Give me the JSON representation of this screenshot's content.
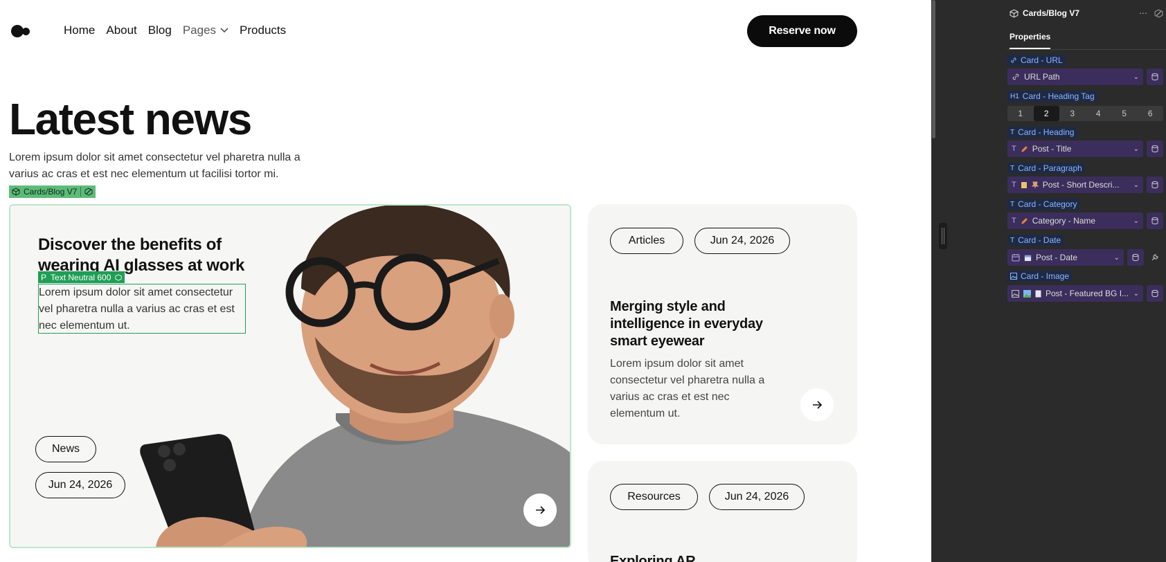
{
  "nav": {
    "items": [
      "Home",
      "About",
      "Blog",
      "Pages",
      "Products"
    ],
    "cta": "Reserve now"
  },
  "hero": {
    "title": "Latest news",
    "subtitle": "Lorem ipsum dolor sit amet consectetur vel pharetra nulla a varius ac cras et est nec elementum ut facilisi tortor mi."
  },
  "selection": {
    "component_badge": "Cards/Blog V7",
    "text_badge_prefix": "P",
    "text_badge": "Text Neutral 600"
  },
  "featured": {
    "heading": "Discover the benefits of wearing AI glasses at work",
    "paragraph": "Lorem ipsum dolor sit amet consectetur vel pharetra nulla a varius ac cras et est nec elementum ut.",
    "category": "News",
    "date": "Jun 24, 2026"
  },
  "cards": [
    {
      "category": "Articles",
      "date": "Jun 24, 2026",
      "heading": "Merging style and intelligence in everyday smart eyewear",
      "paragraph": "Lorem ipsum dolor sit amet consectetur vel pharetra nulla a varius ac cras et est nec elementum ut."
    },
    {
      "category": "Resources",
      "date": "Jun 24, 2026",
      "heading": "Exploring AR"
    }
  ],
  "panel": {
    "component": "Cards/Blog V7",
    "tab": "Properties",
    "props": {
      "url_label": "Card - URL",
      "url_value": "URL Path",
      "heading_tag_label": "Card - Heading Tag",
      "heading_tag_prefix": "H1",
      "heading_tags": [
        "1",
        "2",
        "3",
        "4",
        "5",
        "6"
      ],
      "heading_tag_selected": "2",
      "heading_label": "Card - Heading",
      "heading_value": "Post - Title",
      "paragraph_label": "Card - Paragraph",
      "paragraph_value": "Post - Short Descri...",
      "category_label": "Card - Category",
      "category_value": "Category - Name",
      "date_label": "Card - Date",
      "date_value": "Post - Date",
      "image_label": "Card - Image",
      "image_value": "Post - Featured BG I..."
    },
    "text_prefix": "T"
  },
  "colors": {
    "accent_green": "#1f9e55",
    "selection_green": "#5dbb7a",
    "panel_bg": "#2b2b2b",
    "field_purple": "#3b2e5c",
    "label_blue": "#8db4ff"
  }
}
